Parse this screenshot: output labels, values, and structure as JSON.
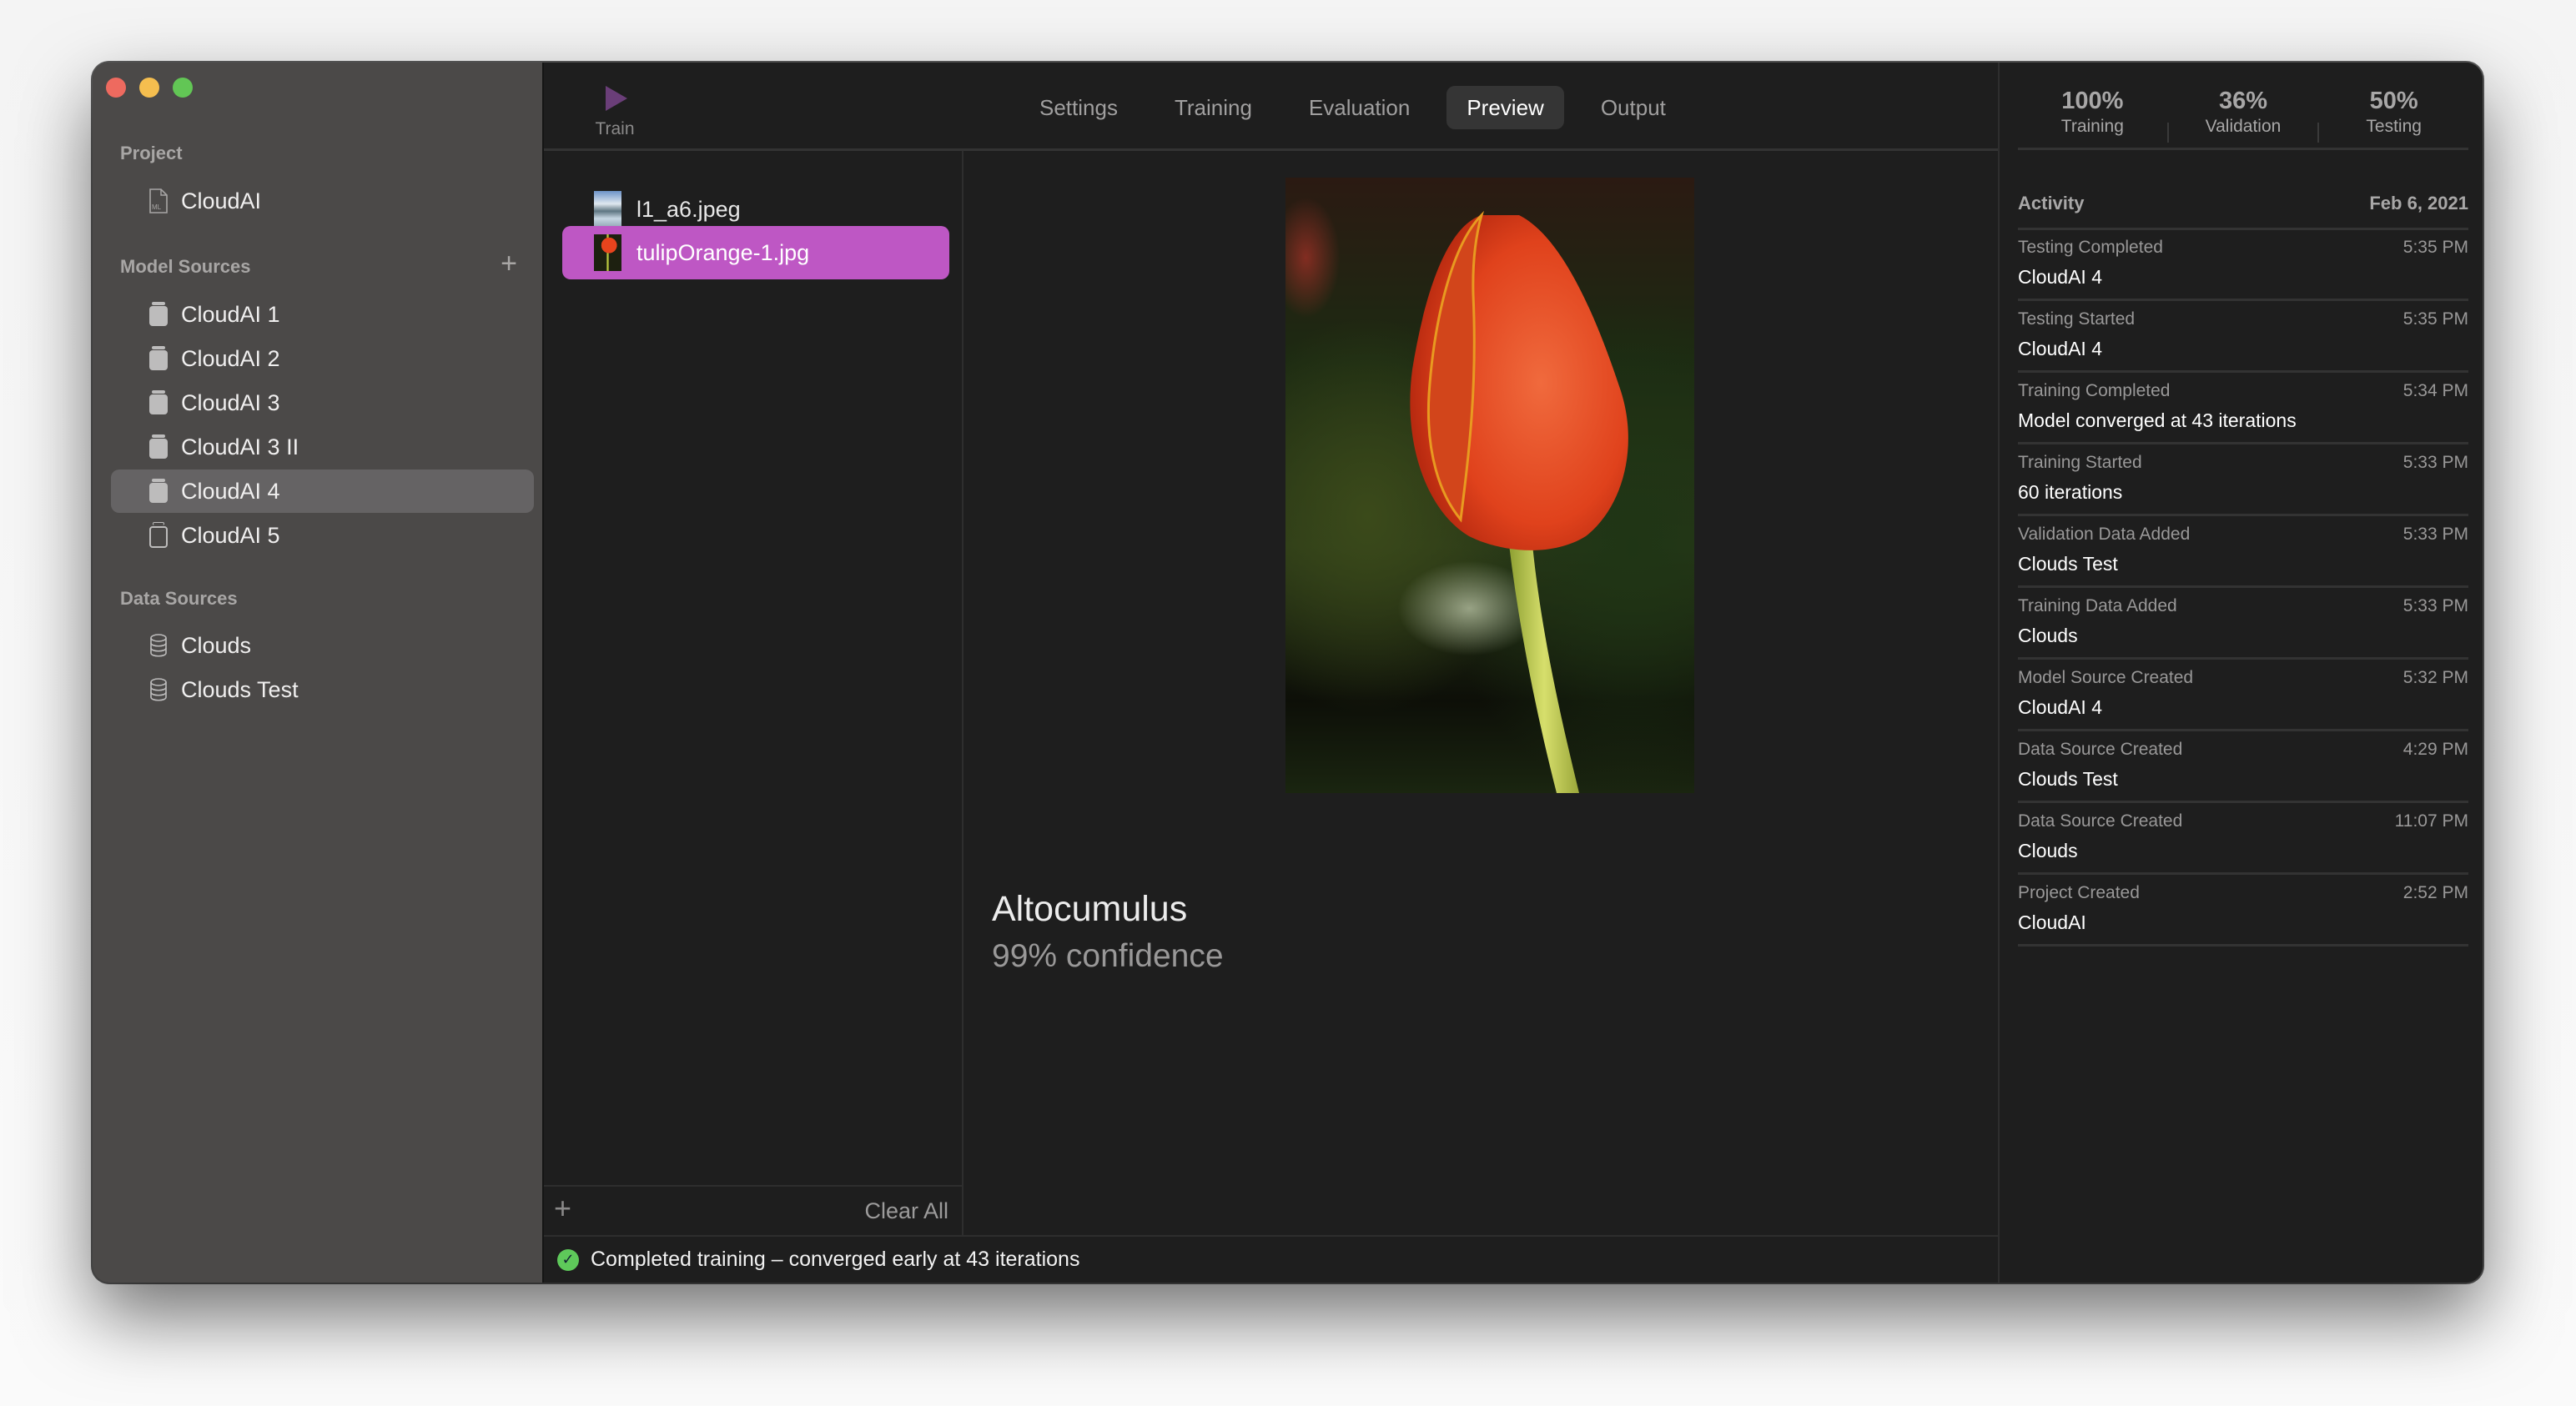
{
  "window": {
    "traffic_lights": [
      "close",
      "minimize",
      "zoom"
    ]
  },
  "sidebar": {
    "project_header": "Project",
    "project": {
      "label": "CloudAI",
      "icon": "ml-file-icon"
    },
    "model_sources_header": "Model Sources",
    "model_sources_add_icon": "plus-icon",
    "model_sources": [
      {
        "label": "CloudAI 1",
        "icon": "model-jar-icon",
        "selected": false
      },
      {
        "label": "CloudAI 2",
        "icon": "model-jar-icon",
        "selected": false
      },
      {
        "label": "CloudAI 3",
        "icon": "model-jar-icon",
        "selected": false
      },
      {
        "label": "CloudAI 3 II",
        "icon": "model-jar-icon",
        "selected": false
      },
      {
        "label": "CloudAI 4",
        "icon": "model-jar-icon",
        "selected": true
      },
      {
        "label": "CloudAI 5",
        "icon": "model-jar-outline-icon",
        "selected": false
      }
    ],
    "data_sources_header": "Data Sources",
    "data_sources": [
      {
        "label": "Clouds",
        "icon": "database-icon"
      },
      {
        "label": "Clouds Test",
        "icon": "database-icon"
      }
    ]
  },
  "toolbar": {
    "train_label": "Train",
    "train_icon": "play-icon",
    "tabs": [
      {
        "label": "Settings",
        "active": false
      },
      {
        "label": "Training",
        "active": false
      },
      {
        "label": "Evaluation",
        "active": false
      },
      {
        "label": "Preview",
        "active": true
      },
      {
        "label": "Output",
        "active": false
      }
    ],
    "activity_label": "Activity",
    "activity_icon": "sidebar-right-icon"
  },
  "files": {
    "items": [
      {
        "name": "l1_a6.jpeg",
        "thumb": "cloud-thumbnail",
        "selected": false
      },
      {
        "name": "tulipOrange-1.jpg",
        "thumb": "tulip-thumbnail",
        "selected": true
      }
    ],
    "add_icon": "plus-icon",
    "clear_all_label": "Clear All"
  },
  "preview": {
    "image_subject": "orange tulip",
    "prediction_label": "Altocumulus",
    "confidence_text": "99% confidence"
  },
  "status_bar": {
    "icon": "checkmark-circle-icon",
    "text": "Completed training – converged early at 43 iterations"
  },
  "stats": [
    {
      "value": "100%",
      "label": "Training"
    },
    {
      "value": "36%",
      "label": "Validation"
    },
    {
      "value": "50%",
      "label": "Testing"
    }
  ],
  "activity": {
    "header": "Activity",
    "date": "Feb 6, 2021",
    "items": [
      {
        "title": "Testing Completed",
        "time": "5:35 PM",
        "detail": "CloudAI 4"
      },
      {
        "title": "Testing Started",
        "time": "5:35 PM",
        "detail": "CloudAI 4"
      },
      {
        "title": "Training Completed",
        "time": "5:34 PM",
        "detail": "Model converged at 43 iterations"
      },
      {
        "title": "Training Started",
        "time": "5:33 PM",
        "detail": "60 iterations"
      },
      {
        "title": "Validation Data Added",
        "time": "5:33 PM",
        "detail": "Clouds Test"
      },
      {
        "title": "Training Data Added",
        "time": "5:33 PM",
        "detail": "Clouds"
      },
      {
        "title": "Model Source Created",
        "time": "5:32 PM",
        "detail": "CloudAI 4"
      },
      {
        "title": "Data Source Created",
        "time": "4:29 PM",
        "detail": "Clouds Test"
      },
      {
        "title": "Data Source Created",
        "time": "11:07 PM",
        "detail": "Clouds"
      },
      {
        "title": "Project Created",
        "time": "2:52 PM",
        "detail": "CloudAI"
      }
    ]
  },
  "colors": {
    "accent_selection": "#be57c4",
    "train_play": "#6a3e78",
    "status_success": "#5ec95a",
    "sidebar_bg": "#4b4948",
    "content_bg": "#1e1e1e"
  }
}
